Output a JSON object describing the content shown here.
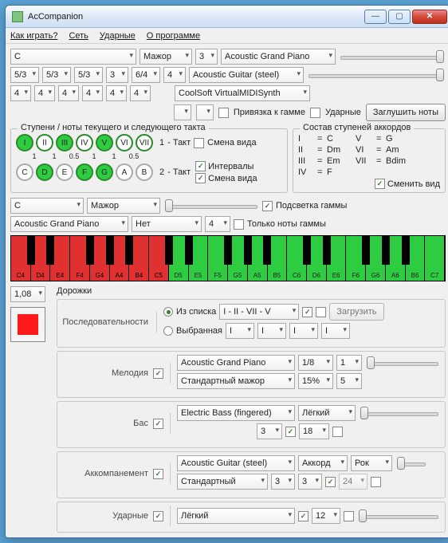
{
  "window": {
    "title": "AcCompanion"
  },
  "menu": {
    "play": "Как играть?",
    "net": "Сеть",
    "drums": "Ударные",
    "about": "О программе"
  },
  "top": {
    "key": "C",
    "mode": "Мажор",
    "num1": "3",
    "instr1": "Acoustic Grand Piano",
    "instr2": "Acoustic Guitar (steel)",
    "midiout": "CoolSoft VirtualMIDISynth",
    "r2a": "5/3",
    "r2b": "5/3",
    "r2c": "5/3",
    "r2d": "3",
    "r2e": "6/4",
    "r2f": "4",
    "r3a": "4",
    "r3b": "4",
    "r3c": "4",
    "r3d": "4",
    "r3e": "4",
    "r3f": "4",
    "bindscale": "Привязка к гамме",
    "drums": "Ударные",
    "mute": "Заглушить ноты"
  },
  "steps": {
    "lbl": "Ступени / ноты текущего и следующего такта",
    "roman": [
      "I",
      "II",
      "III",
      "IV",
      "V",
      "VI",
      "VII"
    ],
    "nums": [
      "1",
      "1",
      "0.5",
      "1",
      "1",
      "0.5"
    ],
    "notes": [
      "C",
      "D",
      "E",
      "F",
      "G",
      "A",
      "B"
    ],
    "t1": "1",
    "takt1": "- Такт",
    "t2": "2",
    "takt2": "- Такт",
    "chview": "Смена вида",
    "interv": "Интервалы",
    "chview2": "Смена вида"
  },
  "chords": {
    "lbl": "Состав ступеней аккордов",
    "r1a": "I",
    "r1b": "C",
    "r1c": "V",
    "r1d": "G",
    "r2a": "II",
    "r2b": "Dm",
    "r2c": "VI",
    "r2d": "Am",
    "r3a": "III",
    "r3b": "Em",
    "r3c": "VII",
    "r3d": "Bdim",
    "r4a": "IV",
    "r4b": "F",
    "toggle": "Сменить вид"
  },
  "mid": {
    "key": "C",
    "mode": "Мажор",
    "hl": "Подсветка гаммы",
    "instr": "Acoustic Grand Piano",
    "sel2": "Нет",
    "num": "4",
    "only": "Только ноты гаммы"
  },
  "keys": [
    {
      "l": "C4",
      "c": "red",
      "b": 1
    },
    {
      "l": "D4",
      "c": "red",
      "b": 1
    },
    {
      "l": "E4",
      "c": "red",
      "b": 0
    },
    {
      "l": "F4",
      "c": "red",
      "b": 1
    },
    {
      "l": "G4",
      "c": "red",
      "b": 1
    },
    {
      "l": "A4",
      "c": "red",
      "b": 1
    },
    {
      "l": "B4",
      "c": "red",
      "b": 0
    },
    {
      "l": "C5",
      "c": "red",
      "b": 1
    },
    {
      "l": "D5",
      "c": "grn",
      "b": 1
    },
    {
      "l": "E5",
      "c": "grn",
      "b": 0
    },
    {
      "l": "F5",
      "c": "grn",
      "b": 1
    },
    {
      "l": "G5",
      "c": "grn",
      "b": 1
    },
    {
      "l": "A5",
      "c": "grn",
      "b": 1
    },
    {
      "l": "B5",
      "c": "grn",
      "b": 0
    },
    {
      "l": "C6",
      "c": "grn",
      "b": 1
    },
    {
      "l": "D6",
      "c": "grn",
      "b": 1
    },
    {
      "l": "E6",
      "c": "grn",
      "b": 0
    },
    {
      "l": "F6",
      "c": "grn",
      "b": 1
    },
    {
      "l": "G6",
      "c": "grn",
      "b": 1
    },
    {
      "l": "A6",
      "c": "grn",
      "b": 1
    },
    {
      "l": "B6",
      "c": "grn",
      "b": 0
    },
    {
      "l": "C7",
      "c": "grn",
      "b": 0
    }
  ],
  "tracks": {
    "hdr": "Дорожки",
    "tempo": "1,08",
    "seq": {
      "lbl": "Последовательности",
      "fromlist": "Из списка",
      "chosen": "Выбранная",
      "preset": "I - II - VII - V",
      "a": "I",
      "b": "I",
      "c": "I",
      "d": "I",
      "load": "Загрузить"
    },
    "mel": {
      "lbl": "Мелодия",
      "instr": "Acoustic Grand Piano",
      "dur": "1/8",
      "n": "1",
      "scale": "Стандартный мажор",
      "pct": "15%",
      "n2": "5"
    },
    "bass": {
      "lbl": "Бас",
      "instr": "Electric Bass (fingered)",
      "style": "Лёгкий",
      "n1": "3",
      "n2": "18"
    },
    "acc": {
      "lbl": "Аккомпанемент",
      "instr": "Acoustic Guitar (steel)",
      "mode": "Аккорд",
      "style": "Рок",
      "sub": "Стандартный",
      "n1": "3",
      "n2": "3",
      "n3": "24"
    },
    "drm": {
      "lbl": "Ударные",
      "style": "Лёгкий",
      "n": "12"
    }
  }
}
